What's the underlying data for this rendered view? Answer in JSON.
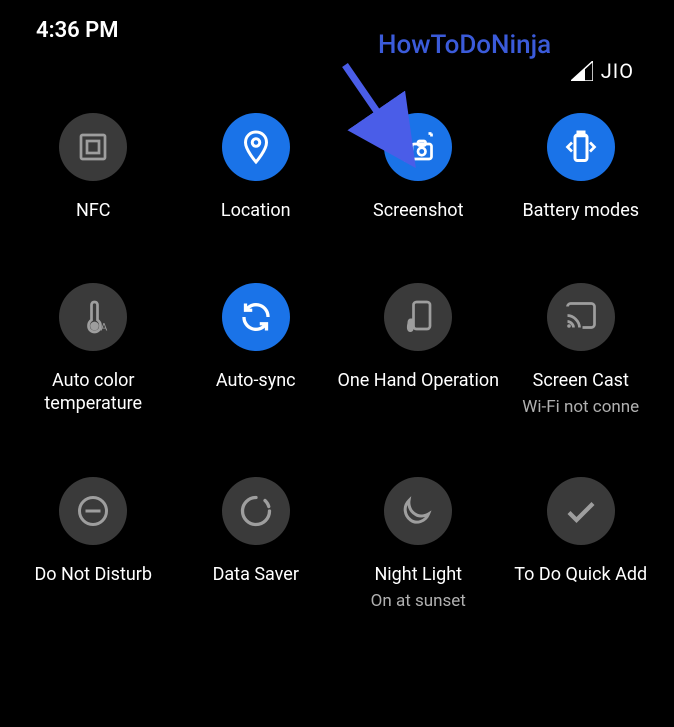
{
  "status": {
    "time": "4:36 PM",
    "carrier": "JIO"
  },
  "overlay": {
    "label": "HowToDoNinja"
  },
  "tiles": [
    {
      "label": "NFC",
      "sublabel": "",
      "state": "off"
    },
    {
      "label": "Location",
      "sublabel": "",
      "state": "on"
    },
    {
      "label": "Screenshot",
      "sublabel": "",
      "state": "on"
    },
    {
      "label": "Battery modes",
      "sublabel": "",
      "state": "on"
    },
    {
      "label": "Auto color temperature",
      "sublabel": "",
      "state": "off"
    },
    {
      "label": "Auto-sync",
      "sublabel": "",
      "state": "on"
    },
    {
      "label": "One Hand Operation",
      "sublabel": "",
      "state": "off"
    },
    {
      "label": "Screen Cast",
      "sublabel": "Wi-Fi not conne",
      "state": "off"
    },
    {
      "label": "Do Not Disturb",
      "sublabel": "",
      "state": "off"
    },
    {
      "label": "Data Saver",
      "sublabel": "",
      "state": "off"
    },
    {
      "label": "Night Light",
      "sublabel": "On at sunset",
      "state": "off"
    },
    {
      "label": "To Do Quick Add",
      "sublabel": "",
      "state": "off"
    }
  ]
}
